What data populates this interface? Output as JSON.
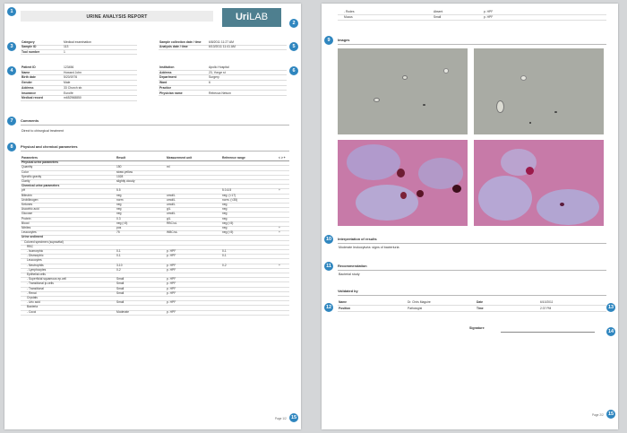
{
  "header": {
    "report_title": "URINE ANALYSIS REPORT",
    "logo_bold": "Uri",
    "logo_light": "LAB"
  },
  "badges": [
    "1",
    "2",
    "3",
    "4",
    "5",
    "6",
    "7",
    "8",
    "9",
    "10",
    "11",
    "12",
    "13",
    "14",
    "15"
  ],
  "meta_left": [
    {
      "k": "Category",
      "v": "Medical examination"
    },
    {
      "k": "Sample ID",
      "v": "113"
    },
    {
      "k": "Tool number",
      "v": "1"
    }
  ],
  "meta_right": [
    {
      "k": "Sample collection date / time",
      "v": "6/8/2011 11:27 AM"
    },
    {
      "k": "Analysis date / time",
      "v": "6/10/2011 11:41 AM"
    }
  ],
  "patient_left": [
    {
      "k": "Patient ID",
      "v": "123456"
    },
    {
      "k": "Name",
      "v": "Howard John"
    },
    {
      "k": "Birth date",
      "v": "5/20/1976"
    },
    {
      "k": "Gender",
      "v": "Male"
    },
    {
      "k": "Address",
      "v": "33 Church str."
    },
    {
      "k": "Insurance",
      "v": "Euroife"
    },
    {
      "k": "Medical record",
      "v": "m652968850"
    }
  ],
  "patient_right": [
    {
      "k": "Institution",
      "v": "Apollo Hospital"
    },
    {
      "k": "Address",
      "v": "23, Yonge st"
    },
    {
      "k": "Department",
      "v": "Surgery"
    },
    {
      "k": "Ward",
      "v": "6"
    },
    {
      "k": "Practice",
      "v": ""
    },
    {
      "k": "Physician name",
      "v": "Rebecca Nelson"
    }
  ],
  "comments": {
    "title": "Comments",
    "text": "Direct to chirurgical treatment"
  },
  "physchem": {
    "title": "Physical and chemical parameters",
    "headers": [
      "Parameters",
      "Result",
      "Measurement unit",
      "Reference range",
      "< > +"
    ],
    "rows": [
      {
        "type": "group",
        "p": "Physical urine parameters"
      },
      {
        "p": "Quantity",
        "r": "150",
        "u": "ml",
        "ref": "",
        "f": ""
      },
      {
        "p": "Color",
        "r": "straw yellow",
        "u": "",
        "ref": "",
        "f": ""
      },
      {
        "p": "Specific gravity",
        "r": "1028",
        "u": "",
        "ref": "",
        "f": ""
      },
      {
        "p": "Clarity",
        "r": "slightly cloudy",
        "u": "",
        "ref": "",
        "f": ""
      },
      {
        "type": "group",
        "p": "Chemical urine parameters"
      },
      {
        "p": "pH",
        "r": "5.5",
        "u": "",
        "ref": "5.0-6.5",
        "f": "+"
      },
      {
        "p": "Bilirubin",
        "r": "neg",
        "u": "umol/L",
        "ref": "neg. (<17)",
        "f": ""
      },
      {
        "p": "Urobilinogen",
        "r": "norm",
        "u": "umol/L",
        "ref": "norm. (<35)",
        "f": ""
      },
      {
        "p": "Ketones",
        "r": "neg",
        "u": "umol/L",
        "ref": "neg",
        "f": ""
      },
      {
        "p": "Ascorbic acid",
        "r": "neg",
        "u": "g/L",
        "ref": "neg",
        "f": ""
      },
      {
        "p": "Glucose",
        "r": "neg",
        "u": "umol/L",
        "ref": "neg",
        "f": ""
      },
      {
        "p": "Protein",
        "r": "0.3",
        "u": "g/L",
        "ref": "neg",
        "f": ""
      },
      {
        "p": "Blood",
        "r": "neg (<5)",
        "u": "RBC/uL",
        "ref": "neg (<5)",
        "f": ""
      },
      {
        "p": "Nitrites",
        "r": "pos",
        "u": "",
        "ref": "neg",
        "f": "+"
      },
      {
        "p": "Leucocytes",
        "r": "75",
        "u": "WBC/uL",
        "ref": "neg (<5)",
        "f": "+"
      },
      {
        "type": "group",
        "p": "Urine sediment"
      },
      {
        "p": "Colored specimen (supravital)",
        "r": "",
        "u": "",
        "ref": "",
        "f": "",
        "ind": 1
      },
      {
        "p": "RBC",
        "r": "",
        "u": "",
        "ref": "",
        "f": "",
        "ind": 2
      },
      {
        "p": "- Isomorphic",
        "r": "0-1",
        "u": "p. HPF",
        "ref": "0-1",
        "f": "",
        "ind": 2
      },
      {
        "p": "- Dismorphic",
        "r": "0-1",
        "u": "p. HPF",
        "ref": "0-1",
        "f": "",
        "ind": 2
      },
      {
        "p": "Leucocytes",
        "r": "",
        "u": "",
        "ref": "",
        "f": "",
        "ind": 2
      },
      {
        "p": "- Neutrophils",
        "r": "3-10",
        "u": "p. HPF",
        "ref": "0-2",
        "f": "+",
        "ind": 2
      },
      {
        "p": "- Lymphocytes",
        "r": "0-2",
        "u": "p. HPF",
        "ref": "",
        "f": "",
        "ind": 2
      },
      {
        "p": "Epithelial cells",
        "r": "",
        "u": "",
        "ref": "",
        "f": "",
        "ind": 2
      },
      {
        "p": "- Superficial squamous ep.cell",
        "r": "Small",
        "u": "p. HPF",
        "ref": "",
        "f": "",
        "ind": 2
      },
      {
        "p": "- Transitional ip.cells",
        "r": "Small",
        "u": "p. HPF",
        "ref": "",
        "f": "",
        "ind": 2
      },
      {
        "p": "- Transitional",
        "r": "Small",
        "u": "p. HPF",
        "ref": "",
        "f": "",
        "ind": 2
      },
      {
        "p": "- Renal",
        "r": "Small",
        "u": "p. HPF",
        "ref": "",
        "f": "",
        "ind": 2
      },
      {
        "p": "Crystals",
        "r": "",
        "u": "",
        "ref": "",
        "f": "",
        "ind": 2
      },
      {
        "p": "- Uric acid",
        "r": "Small",
        "u": "p. HPF",
        "ref": "",
        "f": "",
        "ind": 2
      },
      {
        "p": "Bacteria",
        "r": "",
        "u": "",
        "ref": "",
        "f": "",
        "ind": 2
      },
      {
        "p": "- Cocci",
        "r": "Moderate",
        "u": "p. HPF",
        "ref": "",
        "f": "",
        "ind": 2
      }
    ]
  },
  "page2_rows": [
    {
      "p": "- Rodes",
      "r": "Absent",
      "u": "p. HPF"
    },
    {
      "p": "Mucus",
      "r": "Small",
      "u": "p. HPF"
    }
  ],
  "images": {
    "title": "Images"
  },
  "interpretation": {
    "title": "Interpretation of results",
    "text": "Moderate leukocyturia: signs of bacteriuria"
  },
  "recommendation": {
    "title": "Recommendation",
    "text": "Bacterial study"
  },
  "validated": {
    "title": "Validated by",
    "rows": [
      {
        "k1": "Name",
        "v1": "Dr. Chris Maguire",
        "k2": "Date",
        "v2": "6/10/2011"
      },
      {
        "k1": "Position",
        "v1": "Pathologist",
        "k2": "Time",
        "v2": "2:37 PM"
      }
    ]
  },
  "signature": {
    "label": "Signature"
  },
  "footer": {
    "page1": "Page 1/2",
    "page2": "Page 2/2"
  },
  "colors": {
    "badge": "#2f86bf",
    "logo_bg": "#4e7f8f"
  }
}
